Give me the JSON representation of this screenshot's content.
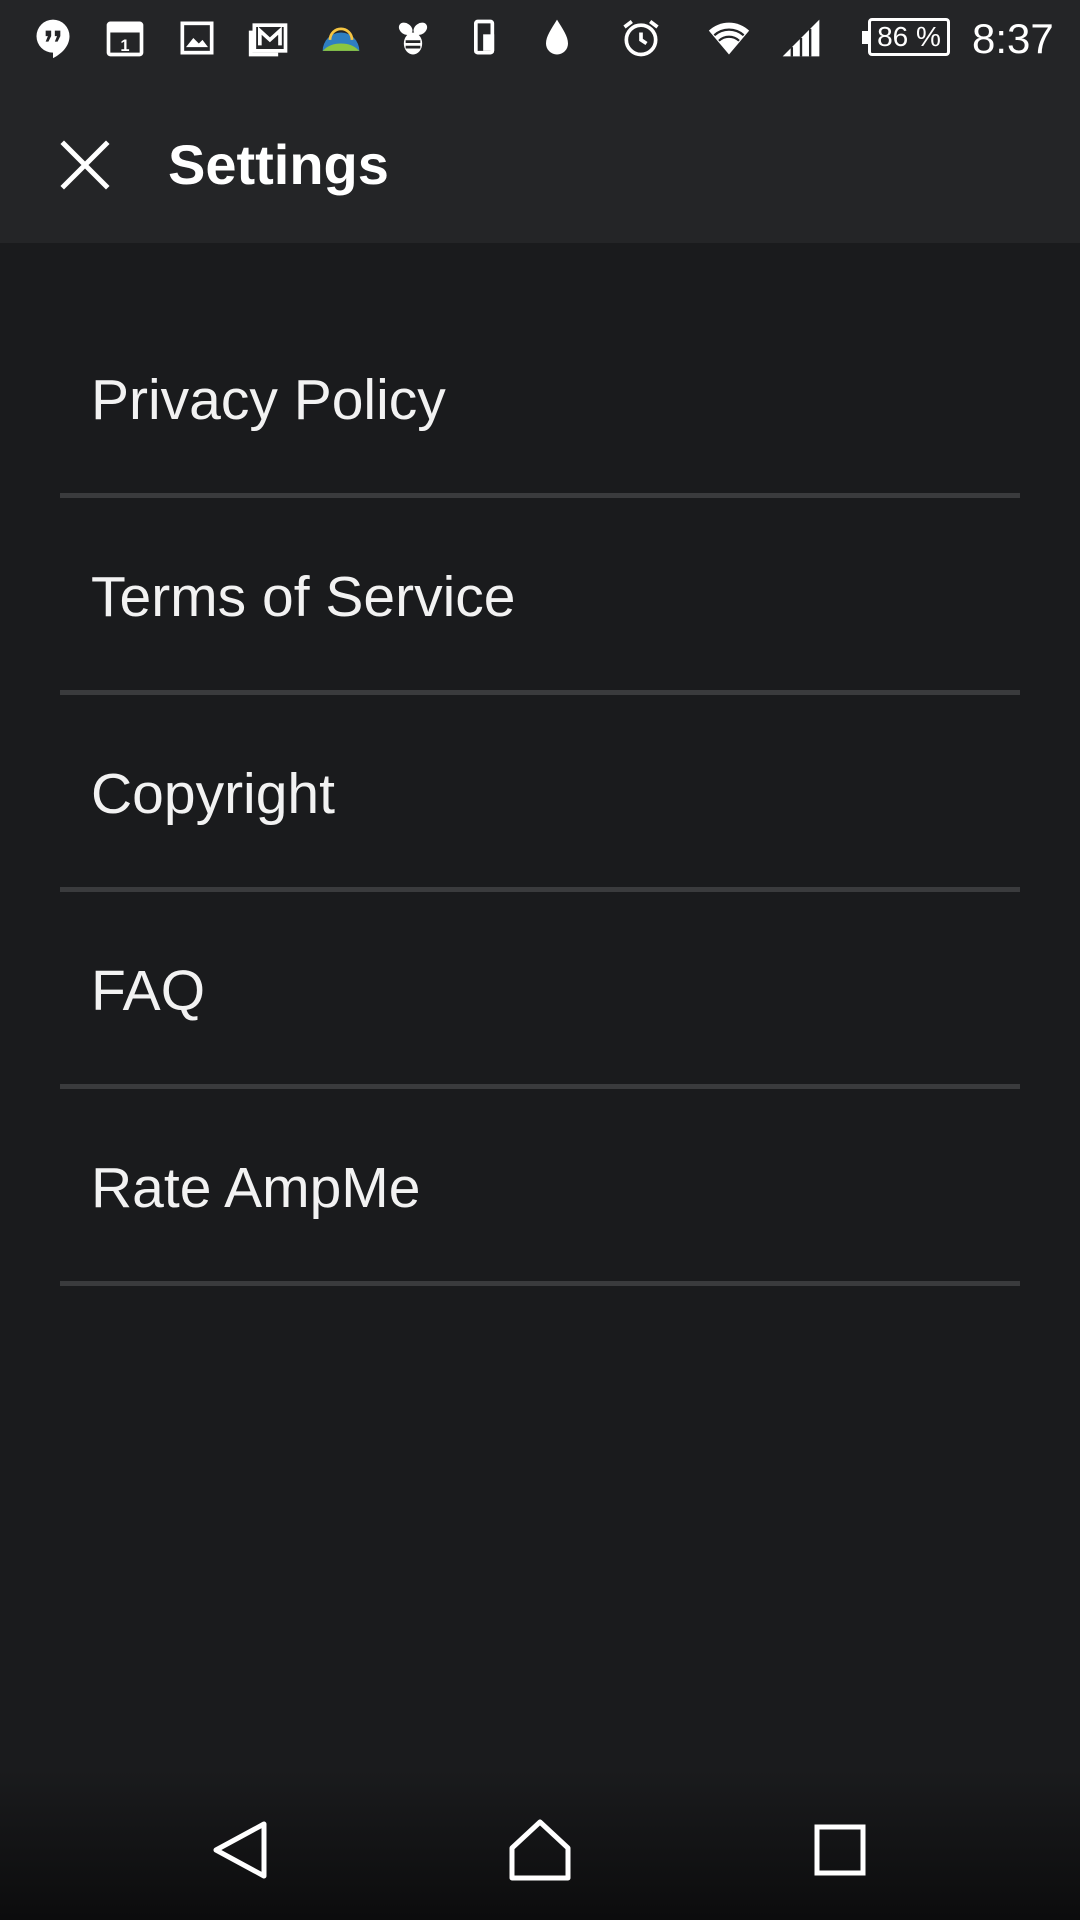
{
  "status_bar": {
    "icons": [
      "hangouts-icon",
      "calendar-icon",
      "gallery-icon",
      "gmail-icon",
      "weather-app-icon",
      "swarm-icon",
      "device-icon",
      "water-drop-icon",
      "alarm-icon",
      "wifi-icon",
      "cell-signal-icon"
    ],
    "calendar_day": "1",
    "battery": "86 %",
    "time": "8:37"
  },
  "app_bar": {
    "title": "Settings",
    "close_icon": "close-icon"
  },
  "menu": {
    "items": [
      {
        "label": "Privacy Policy"
      },
      {
        "label": "Terms of Service"
      },
      {
        "label": "Copyright"
      },
      {
        "label": "FAQ"
      },
      {
        "label": "Rate AmpMe"
      }
    ]
  },
  "nav_bar": {
    "icons": [
      "back-icon",
      "home-icon",
      "recents-icon"
    ]
  },
  "colors": {
    "background": "#1a1b1d",
    "app_bar": "#242527",
    "divider": "#3a3b3d",
    "text": "#ffffff"
  }
}
